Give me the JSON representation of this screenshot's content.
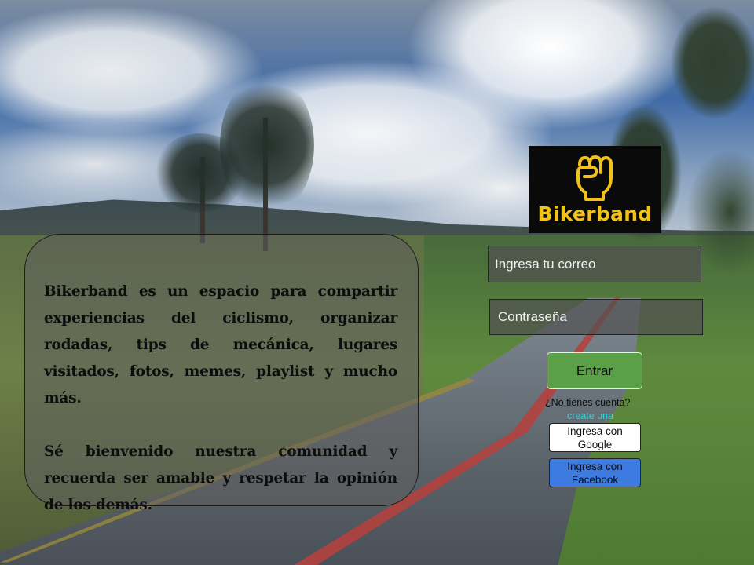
{
  "info": {
    "paragraph1": "Bikerband es un espacio para compartir experiencias del ciclismo, organizar rodadas, tips de mecánica, lugares visitados, fotos, memes, playlist y mucho más.",
    "paragraph2": "Sé bienvenido nuestra comunidad y recuerda ser amable y respetar la opinión de los demás."
  },
  "logo": {
    "icon": "raised-fist-icon",
    "text": "Bikerband",
    "text_color": "#f2c21a",
    "background": "#0a0a0a"
  },
  "form": {
    "email_placeholder": "Ingresa tu correo",
    "password_placeholder": "Contraseña",
    "submit_label": "Entrar",
    "no_account_text": "¿No tienes cuenta?",
    "create_link_text": "create una",
    "google_label": "Ingresa con Google",
    "facebook_label": "Ingresa con Facebook"
  },
  "colors": {
    "submit_button": "#5ba048",
    "facebook_button": "#3d7be0",
    "link": "#29d5d9"
  }
}
